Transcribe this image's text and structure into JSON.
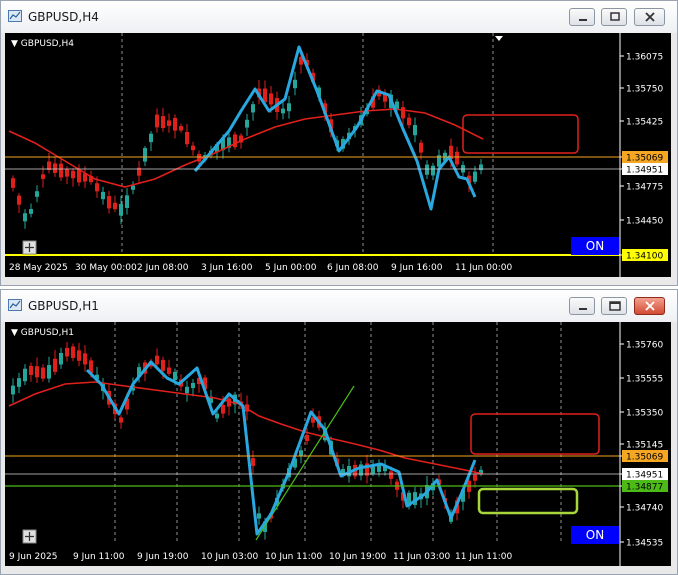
{
  "windows": [
    {
      "title": "GBPUSD,H4",
      "chart_label": "GBPUSD,H4",
      "on_label": "ON",
      "price_ticks": [
        "1.36075",
        "1.35750",
        "1.35425",
        "1.35069",
        "1.34951",
        "1.34775",
        "1.34450",
        "1.34100"
      ],
      "time_ticks": [
        "28 May 2025",
        "30 May 00:00",
        "2 Jun 08:00",
        "3 Jun 16:00",
        "5 Jun 00:00",
        "6 Jun 08:00",
        "9 Jun 16:00",
        "11 Jun 00:00"
      ]
    },
    {
      "title": "GBPUSD,H1",
      "chart_label": "GBPUSD,H1",
      "on_label": "ON",
      "price_ticks": [
        "1.35760",
        "1.35555",
        "1.35350",
        "1.35145",
        "1.35069",
        "1.34951",
        "1.34877",
        "1.34740",
        "1.34535"
      ],
      "time_ticks": [
        "9 Jun 2025",
        "9 Jun 11:00",
        "9 Jun 19:00",
        "10 Jun 03:00",
        "10 Jun 11:00",
        "10 Jun 19:00",
        "11 Jun 03:00",
        "11 Jun 11:00"
      ]
    }
  ],
  "colors": {
    "background": "#000000",
    "bull_candle": "#26a69a",
    "bear_candle": "#e0201b",
    "moving_average": "#e0201b",
    "zigzag": "#29a8e0",
    "orange_level": "#f5a623",
    "yellow_level": "#ffff00",
    "green_level": "#4cbb17",
    "on_badge": "#0000ff"
  }
}
